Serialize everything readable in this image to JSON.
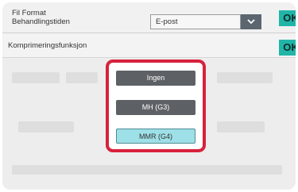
{
  "row_file_format": {
    "label_line1": "Fil Format",
    "label_line2": "Behandlingstiden",
    "dropdown_value": "E-post",
    "ok_label": "OK"
  },
  "row_compression": {
    "label": "Komprimeringsfunksjon",
    "ok_label": "OK"
  },
  "compression_dialog": {
    "options": [
      {
        "label": "Ingen",
        "selected": false
      },
      {
        "label": "MH (G3)",
        "selected": false
      },
      {
        "label": "MMR (G4)",
        "selected": true
      }
    ],
    "highlight_color": "#d8213c"
  },
  "colors": {
    "ok_button": "#21b5a8",
    "dropdown_arrow_bg": "#5c6670",
    "option_default_bg": "#5d6165",
    "option_selected_bg": "#9ee0e7"
  }
}
